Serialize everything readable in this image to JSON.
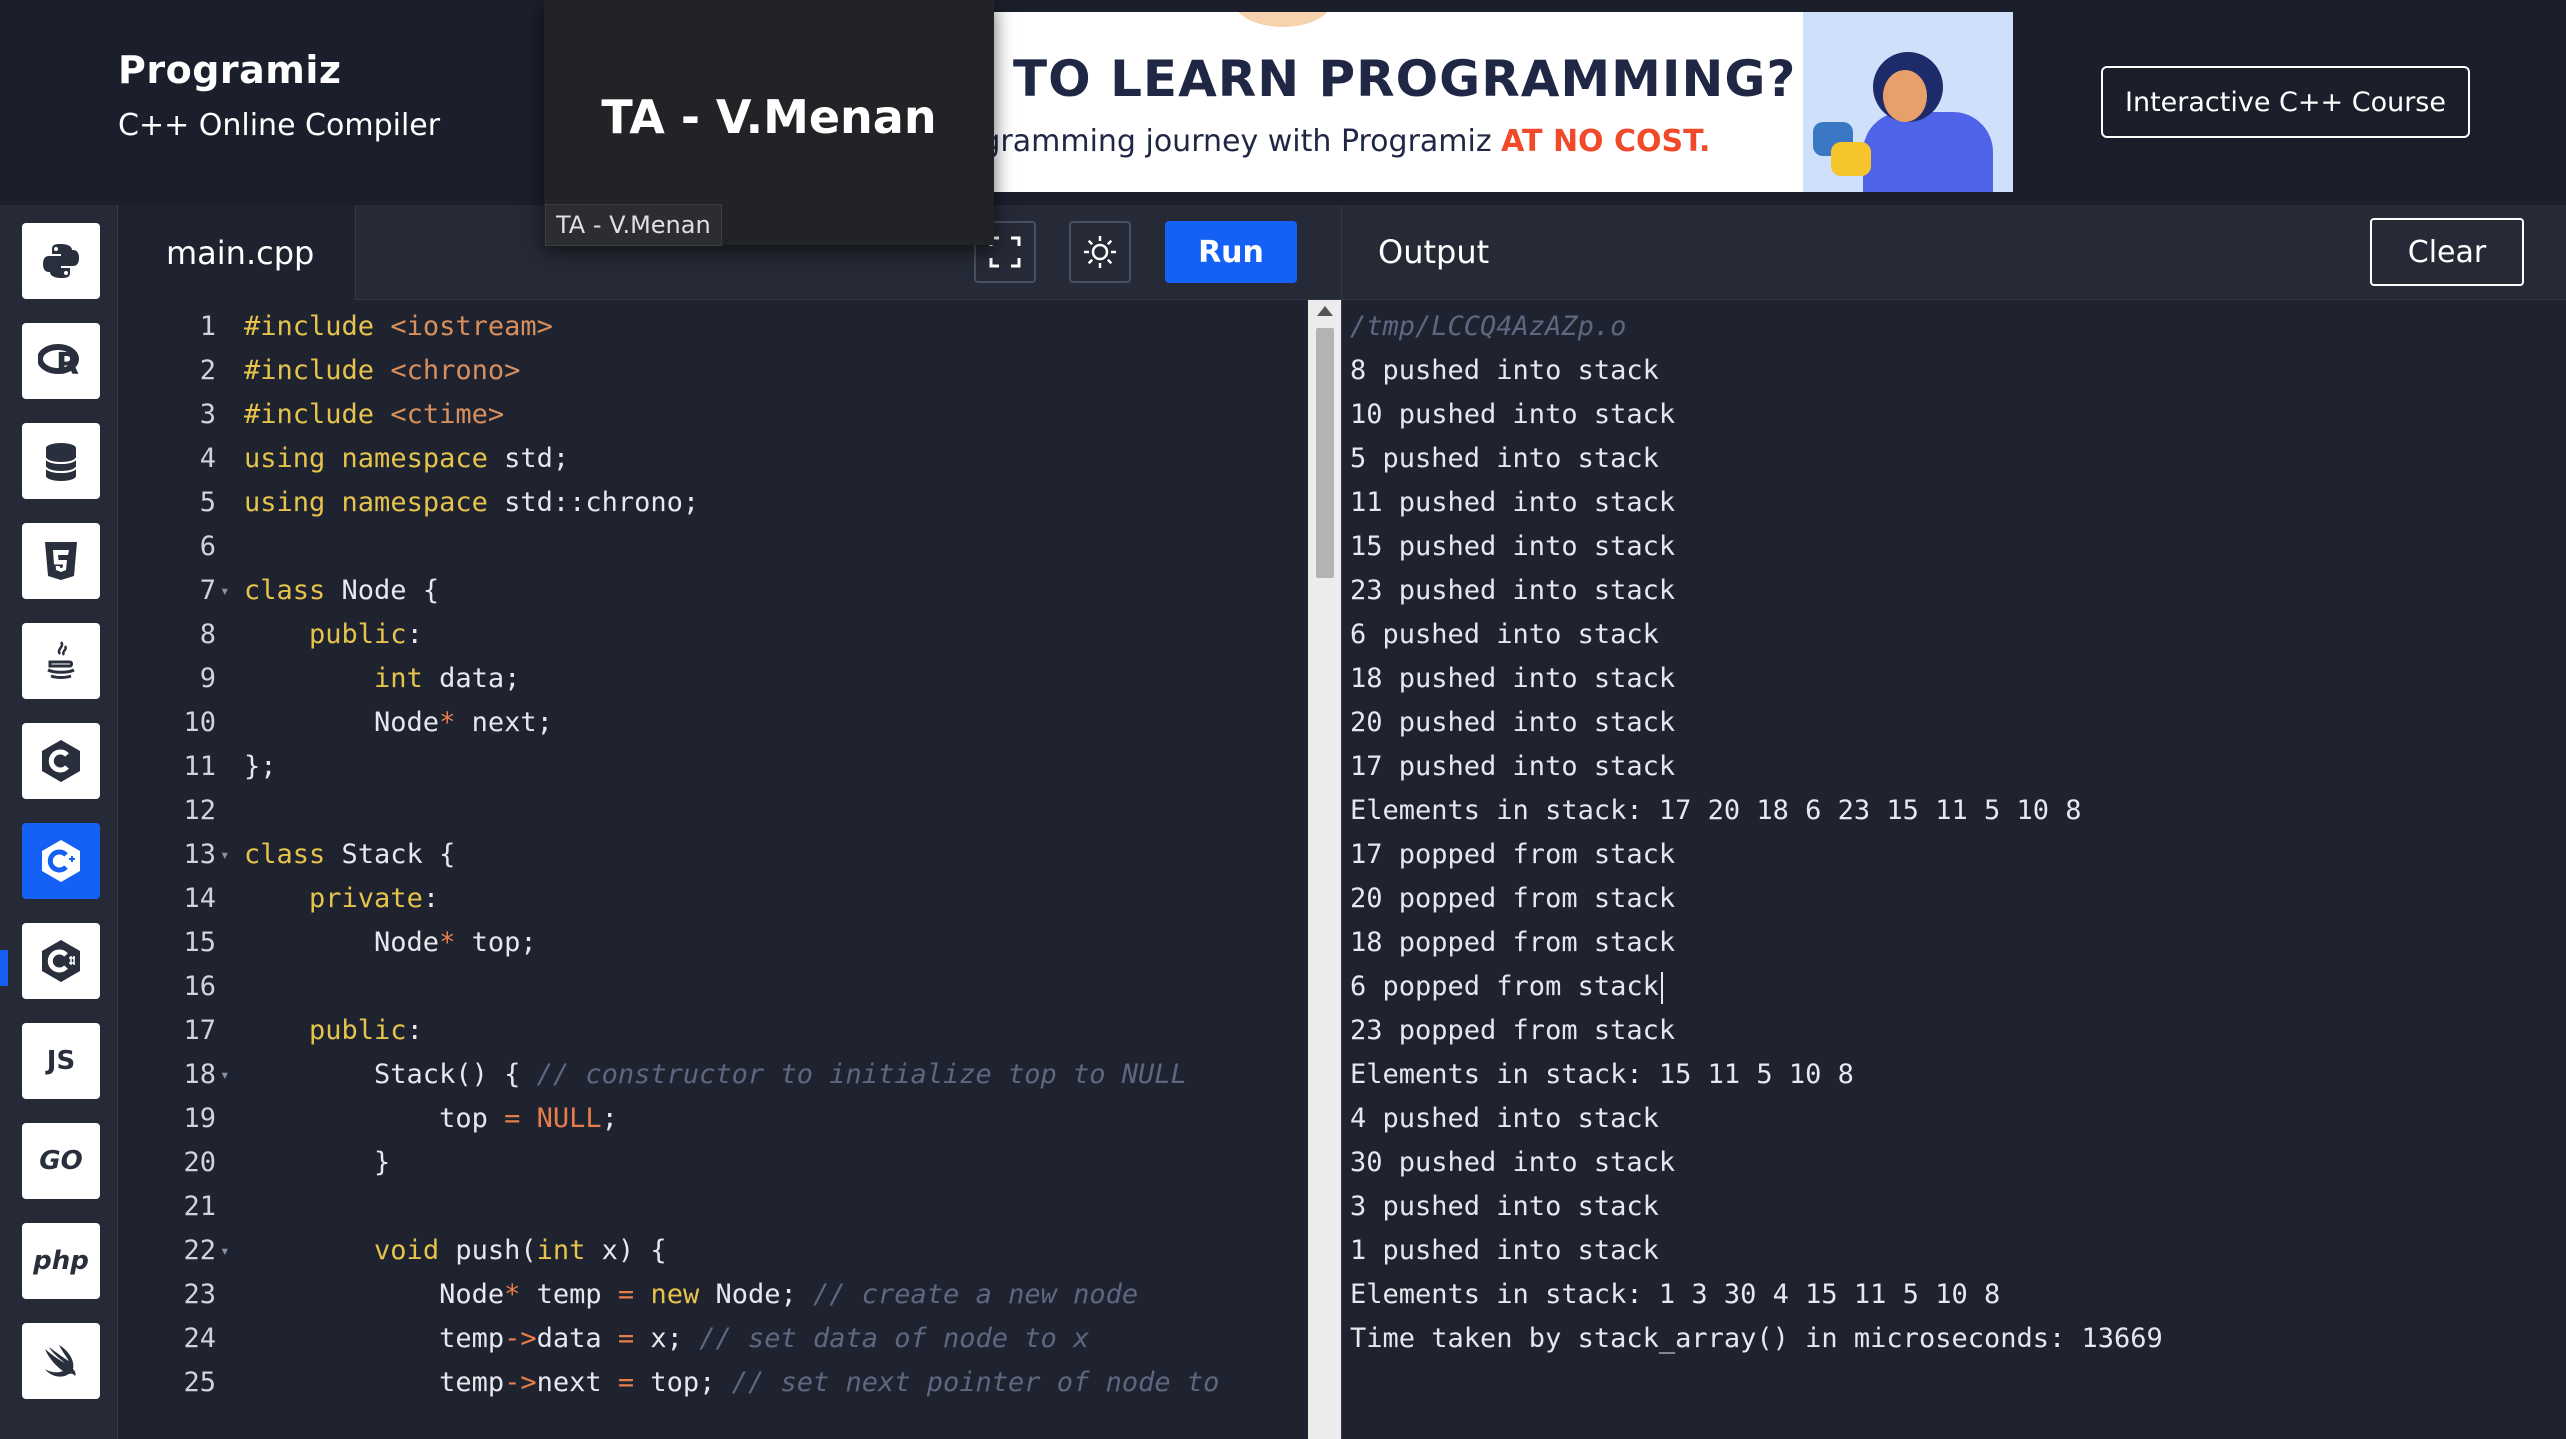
{
  "header": {
    "logo_text": "Programiz",
    "subtitle": "C++ Online Compiler",
    "course_button": "Interactive C++ Course"
  },
  "tab_popup": {
    "title": "TA - V.Menan",
    "tooltip": "TA - V.Menan"
  },
  "banner": {
    "headline": "IG TO LEARN PROGRAMMING?",
    "sub_prefix": "ogramming journey with Programiz ",
    "sub_highlight": "AT NO COST."
  },
  "sidebar": {
    "items": [
      {
        "name": "python",
        "icon": "python-icon"
      },
      {
        "name": "r",
        "icon": "r-icon"
      },
      {
        "name": "sql",
        "icon": "database-icon"
      },
      {
        "name": "html",
        "icon": "html5-icon"
      },
      {
        "name": "java",
        "icon": "java-icon"
      },
      {
        "name": "c",
        "icon": "c-icon"
      },
      {
        "name": "cpp",
        "icon": "cpp-icon",
        "active": true
      },
      {
        "name": "csharp",
        "icon": "csharp-icon"
      },
      {
        "name": "js",
        "label": "JS"
      },
      {
        "name": "go",
        "label": "GO"
      },
      {
        "name": "php",
        "label": "php"
      },
      {
        "name": "swift",
        "icon": "swift-icon"
      }
    ]
  },
  "editor": {
    "file_name": "main.cpp",
    "run_label": "Run",
    "lines": [
      {
        "n": "1",
        "code": "#include <iostream>"
      },
      {
        "n": "2",
        "code": "#include <chrono>"
      },
      {
        "n": "3",
        "code": "#include <ctime>"
      },
      {
        "n": "4",
        "code": "using namespace std;"
      },
      {
        "n": "5",
        "code": "using namespace std::chrono;"
      },
      {
        "n": "6",
        "code": ""
      },
      {
        "n": "7",
        "code": "class Node {"
      },
      {
        "n": "8",
        "code": "    public:"
      },
      {
        "n": "9",
        "code": "        int data;"
      },
      {
        "n": "10",
        "code": "        Node* next;"
      },
      {
        "n": "11",
        "code": "};"
      },
      {
        "n": "12",
        "code": ""
      },
      {
        "n": "13",
        "code": "class Stack {"
      },
      {
        "n": "14",
        "code": "    private:"
      },
      {
        "n": "15",
        "code": "        Node* top;"
      },
      {
        "n": "16",
        "code": ""
      },
      {
        "n": "17",
        "code": "    public:"
      },
      {
        "n": "18",
        "code": "        Stack() { // constructor to initialize top to NULL"
      },
      {
        "n": "19",
        "code": "            top = NULL;"
      },
      {
        "n": "20",
        "code": "        }"
      },
      {
        "n": "21",
        "code": ""
      },
      {
        "n": "22",
        "code": "        void push(int x) {"
      },
      {
        "n": "23",
        "code": "            Node* temp = new Node; // create a new node"
      },
      {
        "n": "24",
        "code": "            temp->data = x; // set data of node to x"
      },
      {
        "n": "25",
        "code": "            temp->next = top; // set next pointer of node to"
      }
    ]
  },
  "output": {
    "title": "Output",
    "clear_label": "Clear",
    "path": "/tmp/LCCQ4AzAZp.o",
    "lines": [
      "8 pushed into stack",
      "10 pushed into stack",
      "5 pushed into stack",
      "11 pushed into stack",
      "15 pushed into stack",
      "23 pushed into stack",
      "6 pushed into stack",
      "18 pushed into stack",
      "20 pushed into stack",
      "17 pushed into stack",
      "Elements in stack: 17 20 18 6 23 15 11 5 10 8",
      "17 popped from stack",
      "20 popped from stack",
      "18 popped from stack",
      "6 popped from stack",
      "23 popped from stack",
      "Elements in stack: 15 11 5 10 8",
      "4 pushed into stack",
      "30 pushed into stack",
      "3 pushed into stack",
      "1 pushed into stack",
      "Elements in stack: 1 3 30 4 15 11 5 10 8",
      "Time taken by stack_array() in microseconds: 13669"
    ]
  },
  "colors": {
    "accent": "#1560f5",
    "background": "#1f2330",
    "keyword": "#e6c34a",
    "comment": "#5f6780"
  }
}
